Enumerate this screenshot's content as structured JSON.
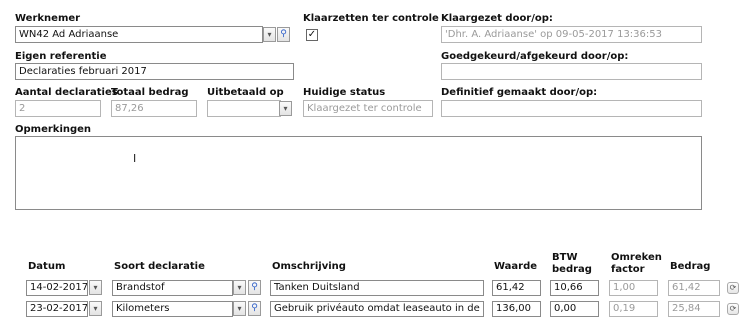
{
  "form": {
    "werknemer": {
      "label": "Werknemer",
      "value": "WN42 Ad Adriaanse"
    },
    "klaarzetten": {
      "label": "Klaarzetten ter controle",
      "checked": true,
      "mark": "✓"
    },
    "klaargezet": {
      "label": "Klaargezet door/op:",
      "value": "'Dhr. A. Adriaanse' op 09-05-2017 13:36:53"
    },
    "eigen_referentie": {
      "label": "Eigen referentie",
      "value": "Declaraties februari 2017"
    },
    "goedgekeurd": {
      "label": "Goedgekeurd/afgekeurd door/op:",
      "value": ""
    },
    "aantal": {
      "label": "Aantal declaraties",
      "value": "2"
    },
    "totaal": {
      "label": "Totaal bedrag",
      "value": "87,26"
    },
    "uitbetaald": {
      "label": "Uitbetaald op",
      "value": ""
    },
    "status": {
      "label": "Huidige status",
      "value": "Klaargezet ter controle"
    },
    "definitief": {
      "label": "Definitief gemaakt door/op:",
      "value": ""
    },
    "opmerkingen": {
      "label": "Opmerkingen",
      "value": ""
    }
  },
  "icons": {
    "dropdown": "▾",
    "search": "⚲",
    "row_action": "⟳",
    "text_cursor": "I"
  },
  "table": {
    "headers": {
      "datum": "Datum",
      "soort": "Soort declaratie",
      "omschrijving": "Omschrijving",
      "waarde": "Waarde",
      "btw_1": "BTW",
      "btw_2": "bedrag",
      "omreken_1": "Omreken",
      "omreken_2": "factor",
      "bedrag": "Bedrag"
    },
    "rows": [
      {
        "datum": "14-02-2017",
        "soort": "Brandstof",
        "omschrijving": "Tanken Duitsland",
        "waarde": "61,42",
        "btw": "10,66",
        "factor": "1,00",
        "bedrag": "61,42"
      },
      {
        "datum": "23-02-2017",
        "soort": "Kilometers",
        "omschrijving": "Gebruik privéauto omdat leaseauto in de garage",
        "waarde": "136,00",
        "btw": "0,00",
        "factor": "0,19",
        "bedrag": "25,84"
      }
    ]
  }
}
